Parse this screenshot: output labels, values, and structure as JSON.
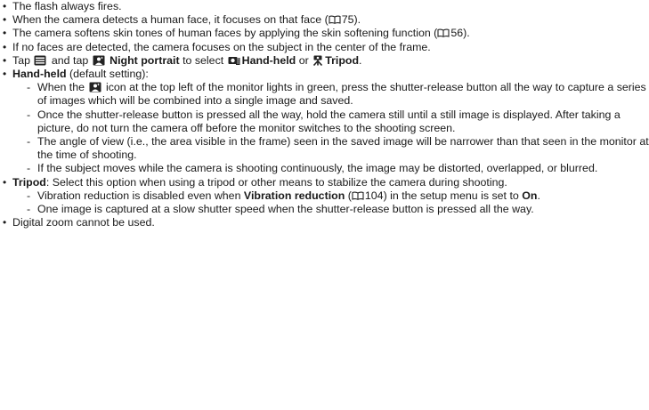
{
  "bullets": {
    "b1": "The flash always fires.",
    "b2": {
      "text": "When the camera detects a human face, it focuses on that face (",
      "ref": "75",
      "end": ")."
    },
    "b3": {
      "text": "The camera softens skin tones of human faces by applying the skin softening function (",
      "ref": "56",
      "end": ")."
    },
    "b4": "If no faces are detected, the camera focuses on the subject in the center of the frame.",
    "b5": {
      "p1": "Tap",
      "p2": "and tap",
      "bold1": "Night portrait",
      "p3": "to select",
      "bold2": "Hand-held",
      "p4": "or",
      "bold3": "Tripod",
      "end": "."
    },
    "b6": {
      "bold": "Hand-held",
      "text": " (default setting):",
      "subs": {
        "s1": {
          "a": "When the",
          "b": "icon at the top left of the monitor lights in green, press the shutter-release button all the way to capture a series of images which will be combined into a single image and saved."
        },
        "s2": "Once the shutter-release button is pressed all the way, hold the camera still until a still image is displayed. After taking a picture, do not turn the camera off before the monitor switches to the shooting screen.",
        "s3": "The angle of view (i.e., the area visible in the frame) seen in the saved image will be narrower than that seen in the monitor at the time of shooting.",
        "s4": "If the subject moves while the camera is shooting continuously, the image may be distorted, overlapped, or blurred."
      }
    },
    "b7": {
      "bold": "Tripod",
      "text": ": Select this option when using a tripod or other means to stabilize the camera during shooting.",
      "subs": {
        "s1": {
          "a": "Vibration reduction is disabled even when",
          "bold": "Vibration reduction",
          "b": " (",
          "ref": "104",
          "c": ") in the setup menu is set to",
          "bold2": "On",
          "end": "."
        },
        "s2": "One image is captured at a slow shutter speed when the shutter-release button is pressed all the way."
      }
    },
    "b8": "Digital zoom cannot be used."
  },
  "icons": {
    "ref": "book-reference-icon",
    "menu": "menu-icon",
    "night_portrait": "night-portrait-icon",
    "hand_held": "hand-held-icon",
    "tripod": "tripod-icon"
  }
}
